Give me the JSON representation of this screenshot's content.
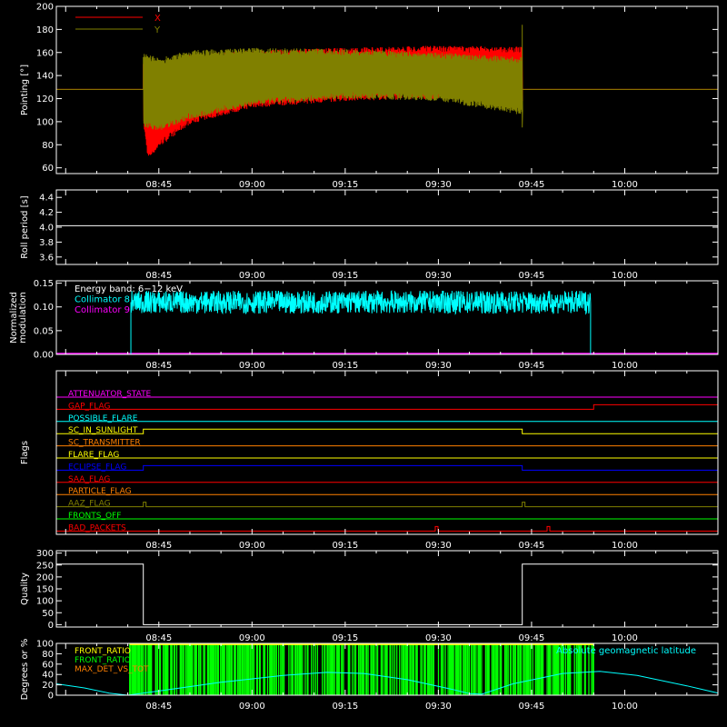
{
  "figure": {
    "background": "#000000",
    "axis_color": "#ffffff"
  },
  "time_axis": {
    "ticks": [
      "08:45",
      "09:00",
      "09:15",
      "09:30",
      "09:45",
      "10:00"
    ],
    "tick_minutes": [
      525,
      540,
      555,
      570,
      585,
      600
    ],
    "range_minutes": [
      508.5,
      615
    ]
  },
  "chart_data": [
    {
      "id": "pointing",
      "type": "line",
      "ylabel": "Pointing [°]",
      "ylim": [
        55,
        200
      ],
      "yticks": [
        "60",
        "80",
        "100",
        "120",
        "140",
        "160",
        "180",
        "200"
      ],
      "ytick_values": [
        60,
        80,
        100,
        120,
        140,
        160,
        180,
        200
      ],
      "legend": [
        {
          "name": "X",
          "color": "#ff0000"
        },
        {
          "name": "Y",
          "color": "#808000"
        }
      ],
      "legend_position": "top-left",
      "series": [
        {
          "name": "X",
          "color": "#ff0000",
          "baseline": 128,
          "active_start_min": 522.5,
          "active_end_min": 583.5,
          "upper_envelope": [
            [
              522.5,
              150
            ],
            [
              525,
              145
            ],
            [
              530,
              158
            ],
            [
              540,
              162
            ],
            [
              555,
              164
            ],
            [
              570,
              166
            ],
            [
              583,
              165
            ]
          ],
          "lower_envelope": [
            [
              522.5,
              95
            ],
            [
              523.2,
              67
            ],
            [
              525,
              78
            ],
            [
              530,
              98
            ],
            [
              540,
              112
            ],
            [
              555,
              118
            ],
            [
              570,
              120
            ],
            [
              583,
              116
            ]
          ]
        },
        {
          "name": "Y",
          "color": "#808000",
          "baseline": 128,
          "active_start_min": 522.5,
          "active_end_min": 583.5,
          "upper_envelope": [
            [
              522.5,
              160
            ],
            [
              525,
              155
            ],
            [
              530,
              162
            ],
            [
              540,
              164
            ],
            [
              555,
              163
            ],
            [
              570,
              160
            ],
            [
              583,
              156
            ]
          ],
          "lower_envelope": [
            [
              522.5,
              95
            ],
            [
              525,
              92
            ],
            [
              530,
              102
            ],
            [
              540,
              114
            ],
            [
              555,
              120
            ],
            [
              570,
              118
            ],
            [
              583,
              106
            ]
          ],
          "end_spike": [
            95,
            184
          ]
        }
      ]
    },
    {
      "id": "roll",
      "type": "line",
      "ylabel": "Roll period [s]",
      "ylim": [
        3.5,
        4.5
      ],
      "yticks": [
        "3.6",
        "3.8",
        "4.0",
        "4.2",
        "4.4"
      ],
      "ytick_values": [
        3.6,
        3.8,
        4.0,
        4.2,
        4.4
      ],
      "series": [
        {
          "name": "roll",
          "color": "#ffffff",
          "values": [
            [
              508.5,
              4.02
            ],
            [
              615,
              4.02
            ]
          ]
        }
      ]
    },
    {
      "id": "modulation",
      "type": "line",
      "ylabel": "Normalized modulation",
      "ylim": [
        0,
        0.155
      ],
      "yticks": [
        "0.00",
        "0.05",
        "0.10",
        "0.15"
      ],
      "ytick_values": [
        0,
        0.05,
        0.1,
        0.15
      ],
      "legend": [
        {
          "name": "Energy band:  6−12 keV",
          "color": "#ffffff"
        },
        {
          "name": "Collimator 8",
          "color": "#00ffff"
        },
        {
          "name": "Collimator 9",
          "color": "#ff00ff"
        }
      ],
      "legend_position": "top-left",
      "series": [
        {
          "name": "Collimator 8",
          "color": "#00ffff",
          "active_start_min": 520.5,
          "active_end_min": 594.5,
          "mean": 0.11,
          "spread": 0.024
        },
        {
          "name": "Collimator 9",
          "color": "#ff00ff",
          "values": [
            [
              508.5,
              0
            ],
            [
              615,
              0
            ]
          ]
        }
      ]
    },
    {
      "id": "flags",
      "type": "line",
      "ylabel": "Flags",
      "flags": [
        {
          "name": "ATTENUATOR_STATE",
          "color": "#ff00ff",
          "steps": []
        },
        {
          "name": "GAP_FLAG",
          "color": "#ff0000",
          "steps": [
            595
          ]
        },
        {
          "name": "POSSIBLE_FLARE",
          "color": "#00ffff",
          "steps": []
        },
        {
          "name": "SC_IN_SUNLIGHT",
          "color": "#ffff00",
          "steps": [
            522.5,
            583.5
          ]
        },
        {
          "name": "SC_TRANSMITTER",
          "color": "#ff8000",
          "steps": []
        },
        {
          "name": "FLARE_FLAG",
          "color": "#ffff00",
          "steps": []
        },
        {
          "name": "ECLIPSE_FLAG",
          "color": "#0000ff",
          "steps": [
            522.5,
            583.5
          ]
        },
        {
          "name": "SAA_FLAG",
          "color": "#ff0000",
          "steps": []
        },
        {
          "name": "PARTICLE_FLAG",
          "color": "#ff8000",
          "steps": []
        },
        {
          "name": "AAZ_FLAG",
          "color": "#808000",
          "pulses": [
            522.5,
            583.5
          ]
        },
        {
          "name": "FRONTS_OFF",
          "color": "#00ff00",
          "steps": []
        },
        {
          "name": "BAD_PACKETS",
          "color": "#ff0000",
          "pulses": [
            569.5,
            587.5
          ]
        }
      ]
    },
    {
      "id": "quality",
      "type": "line",
      "ylabel": "Quality",
      "ylim": [
        -10,
        310
      ],
      "yticks": [
        "0",
        "50",
        "100",
        "150",
        "200",
        "250",
        "300"
      ],
      "ytick_values": [
        0,
        50,
        100,
        150,
        200,
        250,
        300
      ],
      "series": [
        {
          "name": "quality",
          "color": "#ffffff",
          "values": [
            [
              508.5,
              254
            ],
            [
              522.5,
              254
            ],
            [
              522.5,
              0
            ],
            [
              583.5,
              0
            ],
            [
              583.5,
              254
            ],
            [
              615,
              254
            ]
          ]
        }
      ]
    },
    {
      "id": "ratios",
      "type": "line",
      "ylabel": "Degrees or %",
      "ylim": [
        0,
        100
      ],
      "yticks": [
        "0",
        "20",
        "40",
        "60",
        "80",
        "100"
      ],
      "ytick_values": [
        0,
        20,
        40,
        60,
        80,
        100
      ],
      "legend": [
        {
          "name": "FRONT_RATIO",
          "color": "#ffff00"
        },
        {
          "name": "FRONT_RATIO",
          "color": "#00ff00"
        },
        {
          "name": "MAX_DET_VS_TOT",
          "color": "#ff8000"
        }
      ],
      "legend_position": "top-left",
      "right_label": {
        "name": "Absolute geomagnetic latitude",
        "color": "#00ffff"
      },
      "series": [
        {
          "name": "Absolute geomagnetic latitude",
          "color": "#00ffff",
          "values": [
            [
              508.5,
              22
            ],
            [
              513,
              14
            ],
            [
              517,
              4
            ],
            [
              520,
              0
            ],
            [
              525,
              8
            ],
            [
              535,
              25
            ],
            [
              545,
              38
            ],
            [
              552,
              44
            ],
            [
              558,
              42
            ],
            [
              565,
              30
            ],
            [
              572,
              12
            ],
            [
              575,
              3
            ],
            [
              577,
              2
            ],
            [
              582,
              22
            ],
            [
              590,
              42
            ],
            [
              596,
              46
            ],
            [
              602,
              38
            ],
            [
              610,
              18
            ],
            [
              615,
              4
            ]
          ]
        },
        {
          "name": "FRONT_RATIO",
          "color": "#00ff00",
          "active_start_min": 520.3,
          "active_end_min": 595
        },
        {
          "name": "FRONT_RATIO",
          "color": "#ffff00",
          "active_start_min": 520.3,
          "active_end_min": 595
        }
      ]
    }
  ]
}
